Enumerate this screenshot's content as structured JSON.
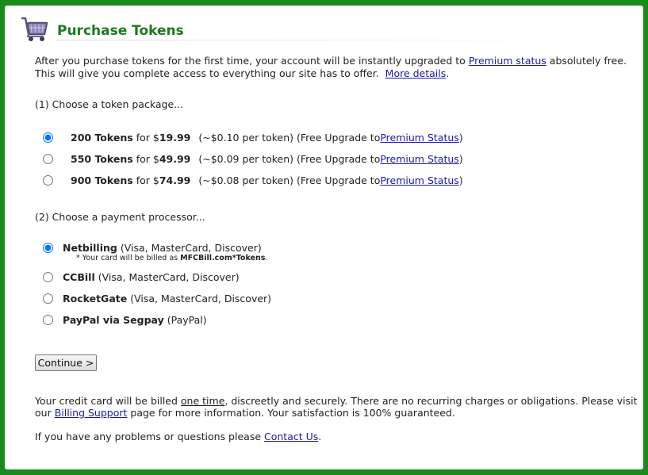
{
  "header": {
    "title": "Purchase Tokens",
    "icon": "shopping-cart-icon"
  },
  "intro": {
    "line1_before": "After you purchase tokens for the first time, your account will be instantly upgraded to ",
    "line1_link": "Premium status",
    "line1_after": " absolutely free.",
    "line2_before": "This will give you complete access to everything our site has to offer.",
    "line2_link": "More details",
    "line2_after": "."
  },
  "step1_label": "(1) Choose a token package...",
  "packages": [
    {
      "amount": "200 Tokens",
      "for": "for $",
      "price": "19.99",
      "per": "(~$0.10 per token) (Free Upgrade to ",
      "link": "Premium Status",
      "close": ")",
      "selected": true
    },
    {
      "amount": "550 Tokens",
      "for": "for $",
      "price": "49.99",
      "per": "(~$0.09 per token) (Free Upgrade to ",
      "link": "Premium Status",
      "close": ")",
      "selected": false
    },
    {
      "amount": "900 Tokens",
      "for": "for $",
      "price": "74.99",
      "per": "(~$0.08 per token) (Free Upgrade to ",
      "link": "Premium Status",
      "close": ")",
      "selected": false
    }
  ],
  "step2_label": "(2) Choose a payment processor...",
  "processors": [
    {
      "name": "Netbilling",
      "cards": "(Visa, MasterCard, Discover)",
      "selected": true
    },
    {
      "name": "CCBill",
      "cards": "(Visa, MasterCard, Discover)",
      "selected": false
    },
    {
      "name": "RocketGate",
      "cards": "(Visa, MasterCard, Discover)",
      "selected": false
    },
    {
      "name": "PayPal via Segpay",
      "cards": "(PayPal)",
      "selected": false
    }
  ],
  "netbilling_note": {
    "before": "* Your card will be billed as ",
    "bold": "MFCBill.com*Tokens",
    "after": "."
  },
  "continue_label": "Continue >",
  "footer": {
    "p1_a": "Your credit card will be billed ",
    "p1_u": "one time",
    "p1_b": ", discreetly and securely. There are no recurring charges or obligations. Please visit",
    "p1_c": "our ",
    "p1_link": "Billing Support",
    "p1_d": " page for more information. Your satisfaction is 100% guaranteed.",
    "p2_a": "If you have any problems or questions please ",
    "p2_link": "Contact Us",
    "p2_b": "."
  },
  "colors": {
    "frame": "#1a8a1a",
    "title": "#1e7a1e",
    "link": "#1a1aa6"
  }
}
